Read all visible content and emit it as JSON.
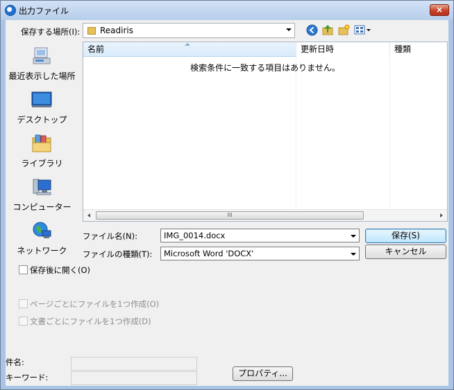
{
  "window": {
    "title": "出力ファイル",
    "close": "×"
  },
  "toolbar": {
    "location_label": "保存する場所(I):",
    "location_value": "Readiris",
    "icons": [
      "back-icon",
      "up-folder-icon",
      "new-folder-icon",
      "view-menu-icon"
    ]
  },
  "places": [
    {
      "label": "最近表示した場所",
      "icon": "recent-places-icon"
    },
    {
      "label": "デスクトップ",
      "icon": "desktop-icon"
    },
    {
      "label": "ライブラリ",
      "icon": "libraries-icon"
    },
    {
      "label": "コンピューター",
      "icon": "computer-icon"
    },
    {
      "label": "ネットワーク",
      "icon": "network-icon"
    }
  ],
  "list": {
    "columns": [
      "名前",
      "更新日時",
      "種類"
    ],
    "empty_message": "検索条件に一致する項目はありません。",
    "scroll_grip": "III"
  },
  "form": {
    "filename_label": "ファイル名(N):",
    "filename_value": "IMG_0014.docx",
    "filetype_label": "ファイルの種類(T):",
    "filetype_value": "Microsoft Word 'DOCX'",
    "save_button": "保存(S)",
    "cancel_button": "キャンセル"
  },
  "options": {
    "open_after_save": "保存後に開く(O)",
    "one_file_per_page": "ページごとにファイルを1つ作成(O)",
    "one_file_per_document": "文書ごとにファイルを1つ作成(D)"
  },
  "properties": {
    "subject_label": "件名:",
    "keywords_label": "キーワード:",
    "properties_button": "プロパティ..."
  },
  "colors": {
    "title_bar": "#b6cdea",
    "close_button": "#c7432a",
    "dialog_bg": "#f0f0f0",
    "default_button": "#bee6fd"
  }
}
